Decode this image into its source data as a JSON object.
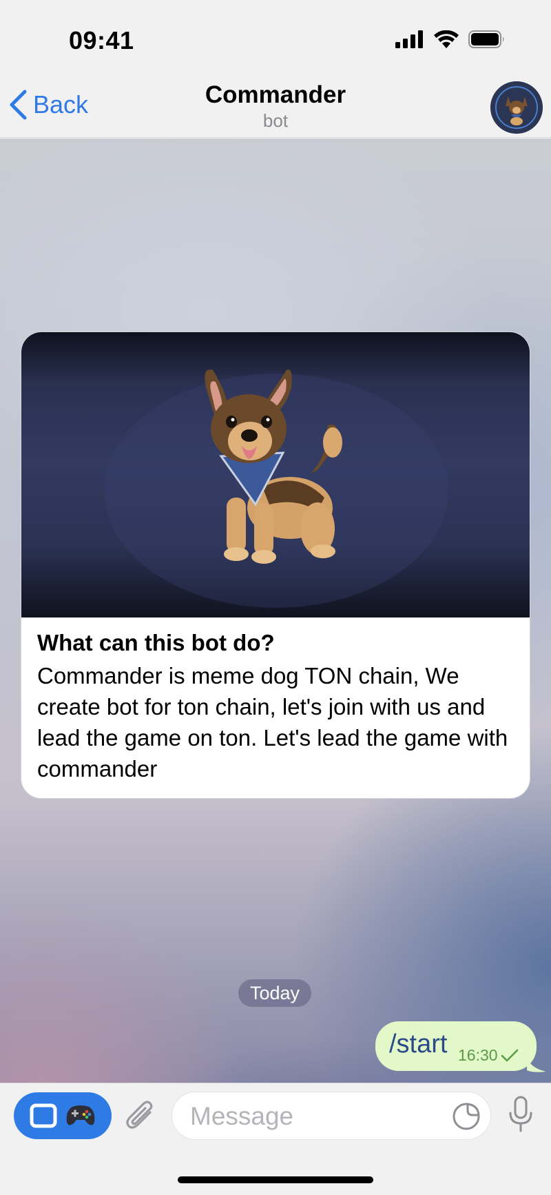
{
  "status_bar": {
    "time": "09:41"
  },
  "nav": {
    "back_label": "Back",
    "title": "Commander",
    "subtitle": "bot"
  },
  "bot_card": {
    "title": "What can this bot do?",
    "body": "Commander is meme dog TON chain, We create bot for ton chain, let's join with us and lead the game on ton. Let's lead the game with commander"
  },
  "chat": {
    "date_label": "Today",
    "messages": [
      {
        "text": "/start",
        "time": "16:30",
        "status": "sent"
      }
    ]
  },
  "input": {
    "placeholder": "Message"
  },
  "colors": {
    "accent": "#2f7ae5",
    "outgoing_bubble": "#e3f8c8",
    "outgoing_time": "#5a9a48"
  },
  "icons": {
    "back": "chevron-left-icon",
    "signal": "signal-icon",
    "wifi": "wifi-icon",
    "battery": "battery-icon",
    "app": "window-icon",
    "game": "gamepad-icon",
    "attach": "paperclip-icon",
    "sticker": "sticker-icon",
    "mic": "microphone-icon",
    "check": "check-icon"
  }
}
